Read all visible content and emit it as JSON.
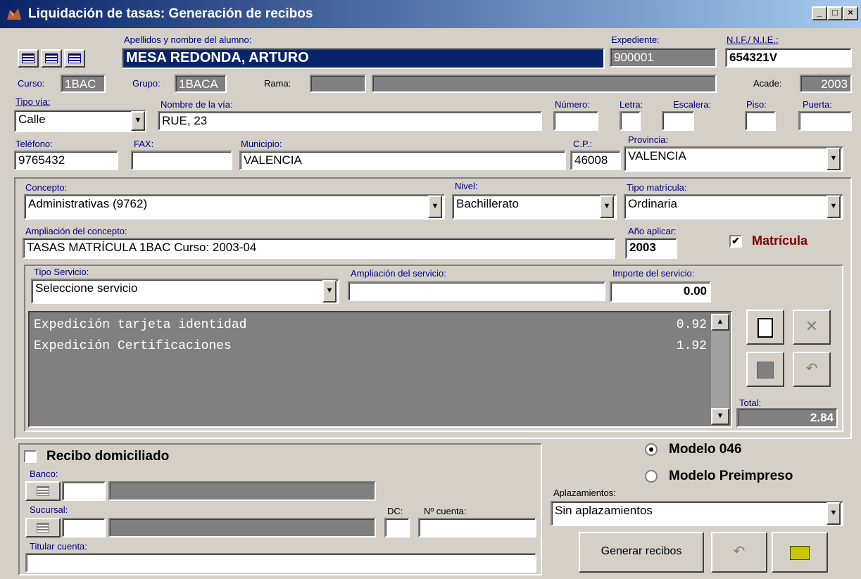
{
  "window": {
    "title": "Liquidación de tasas: Generación de recibos"
  },
  "student": {
    "name_label": "Apellidos y nombre del alumno:",
    "name": "MESA REDONDA, ARTURO",
    "expediente_label": "Expediente:",
    "expediente": "900001",
    "nif_label": "N.I.F./ N.I.E.:",
    "nif": "654321V",
    "curso_label": "Curso:",
    "curso": "1BAC",
    "grupo_label": "Grupo:",
    "grupo": "1BACA",
    "rama_label": "Rama:",
    "acade_label": "Acade:",
    "acade": "2003"
  },
  "address": {
    "tipo_via_label": "Tipo vía:",
    "tipo_via": "Calle",
    "nombre_via_label": "Nombre de la vía:",
    "nombre_via": "RUE, 23",
    "numero_label": "Número:",
    "letra_label": "Letra:",
    "escalera_label": "Escalera:",
    "piso_label": "Piso:",
    "puerta_label": "Puerta:",
    "telefono_label": "Teléfono:",
    "telefono": "9765432",
    "fax_label": "FAX:",
    "municipio_label": "Municipio:",
    "municipio": "VALENCIA",
    "cp_label": "C.P.:",
    "cp": "46008",
    "provincia_label": "Provincia:",
    "provincia": "VALENCIA"
  },
  "concept": {
    "concepto_label": "Concepto:",
    "concepto": "Administrativas (9762)",
    "nivel_label": "Nivel:",
    "nivel": "Bachillerato",
    "tipo_matricula_label": "Tipo matrícula:",
    "tipo_matricula": "Ordinaria",
    "ampliacion_label": "Ampliación del concepto:",
    "ampliacion": "TASAS MATRÍCULA 1BAC  Curso: 2003-04",
    "anio_label": "Año aplicar:",
    "anio": "2003",
    "matricula_label": "Matrícula",
    "matricula_checked": true
  },
  "service": {
    "tipo_label": "Tipo Servicio:",
    "tipo": "Seleccione servicio",
    "ampliacion_label": "Ampliación del servicio:",
    "importe_label": "Importe del servicio:",
    "importe": "0.00",
    "items": [
      {
        "name": "Expedición tarjeta identidad",
        "amount": "0.92"
      },
      {
        "name": "Expedición Certificaciones",
        "amount": "1.92"
      }
    ],
    "total_label": "Total:",
    "total": "2.84"
  },
  "bank": {
    "domiciliado_label": "Recibo domiciliado",
    "banco_label": "Banco:",
    "sucursal_label": "Sucursal:",
    "dc_label": "DC:",
    "cuenta_label": "Nº cuenta:",
    "titular_label": "Titular cuenta:"
  },
  "model": {
    "modelo046": "Modelo 046",
    "preimpreso": "Modelo Preimpreso",
    "aplaz_label": "Aplazamientos:",
    "aplaz": "Sin aplazamientos",
    "generar": "Generar recibos"
  }
}
